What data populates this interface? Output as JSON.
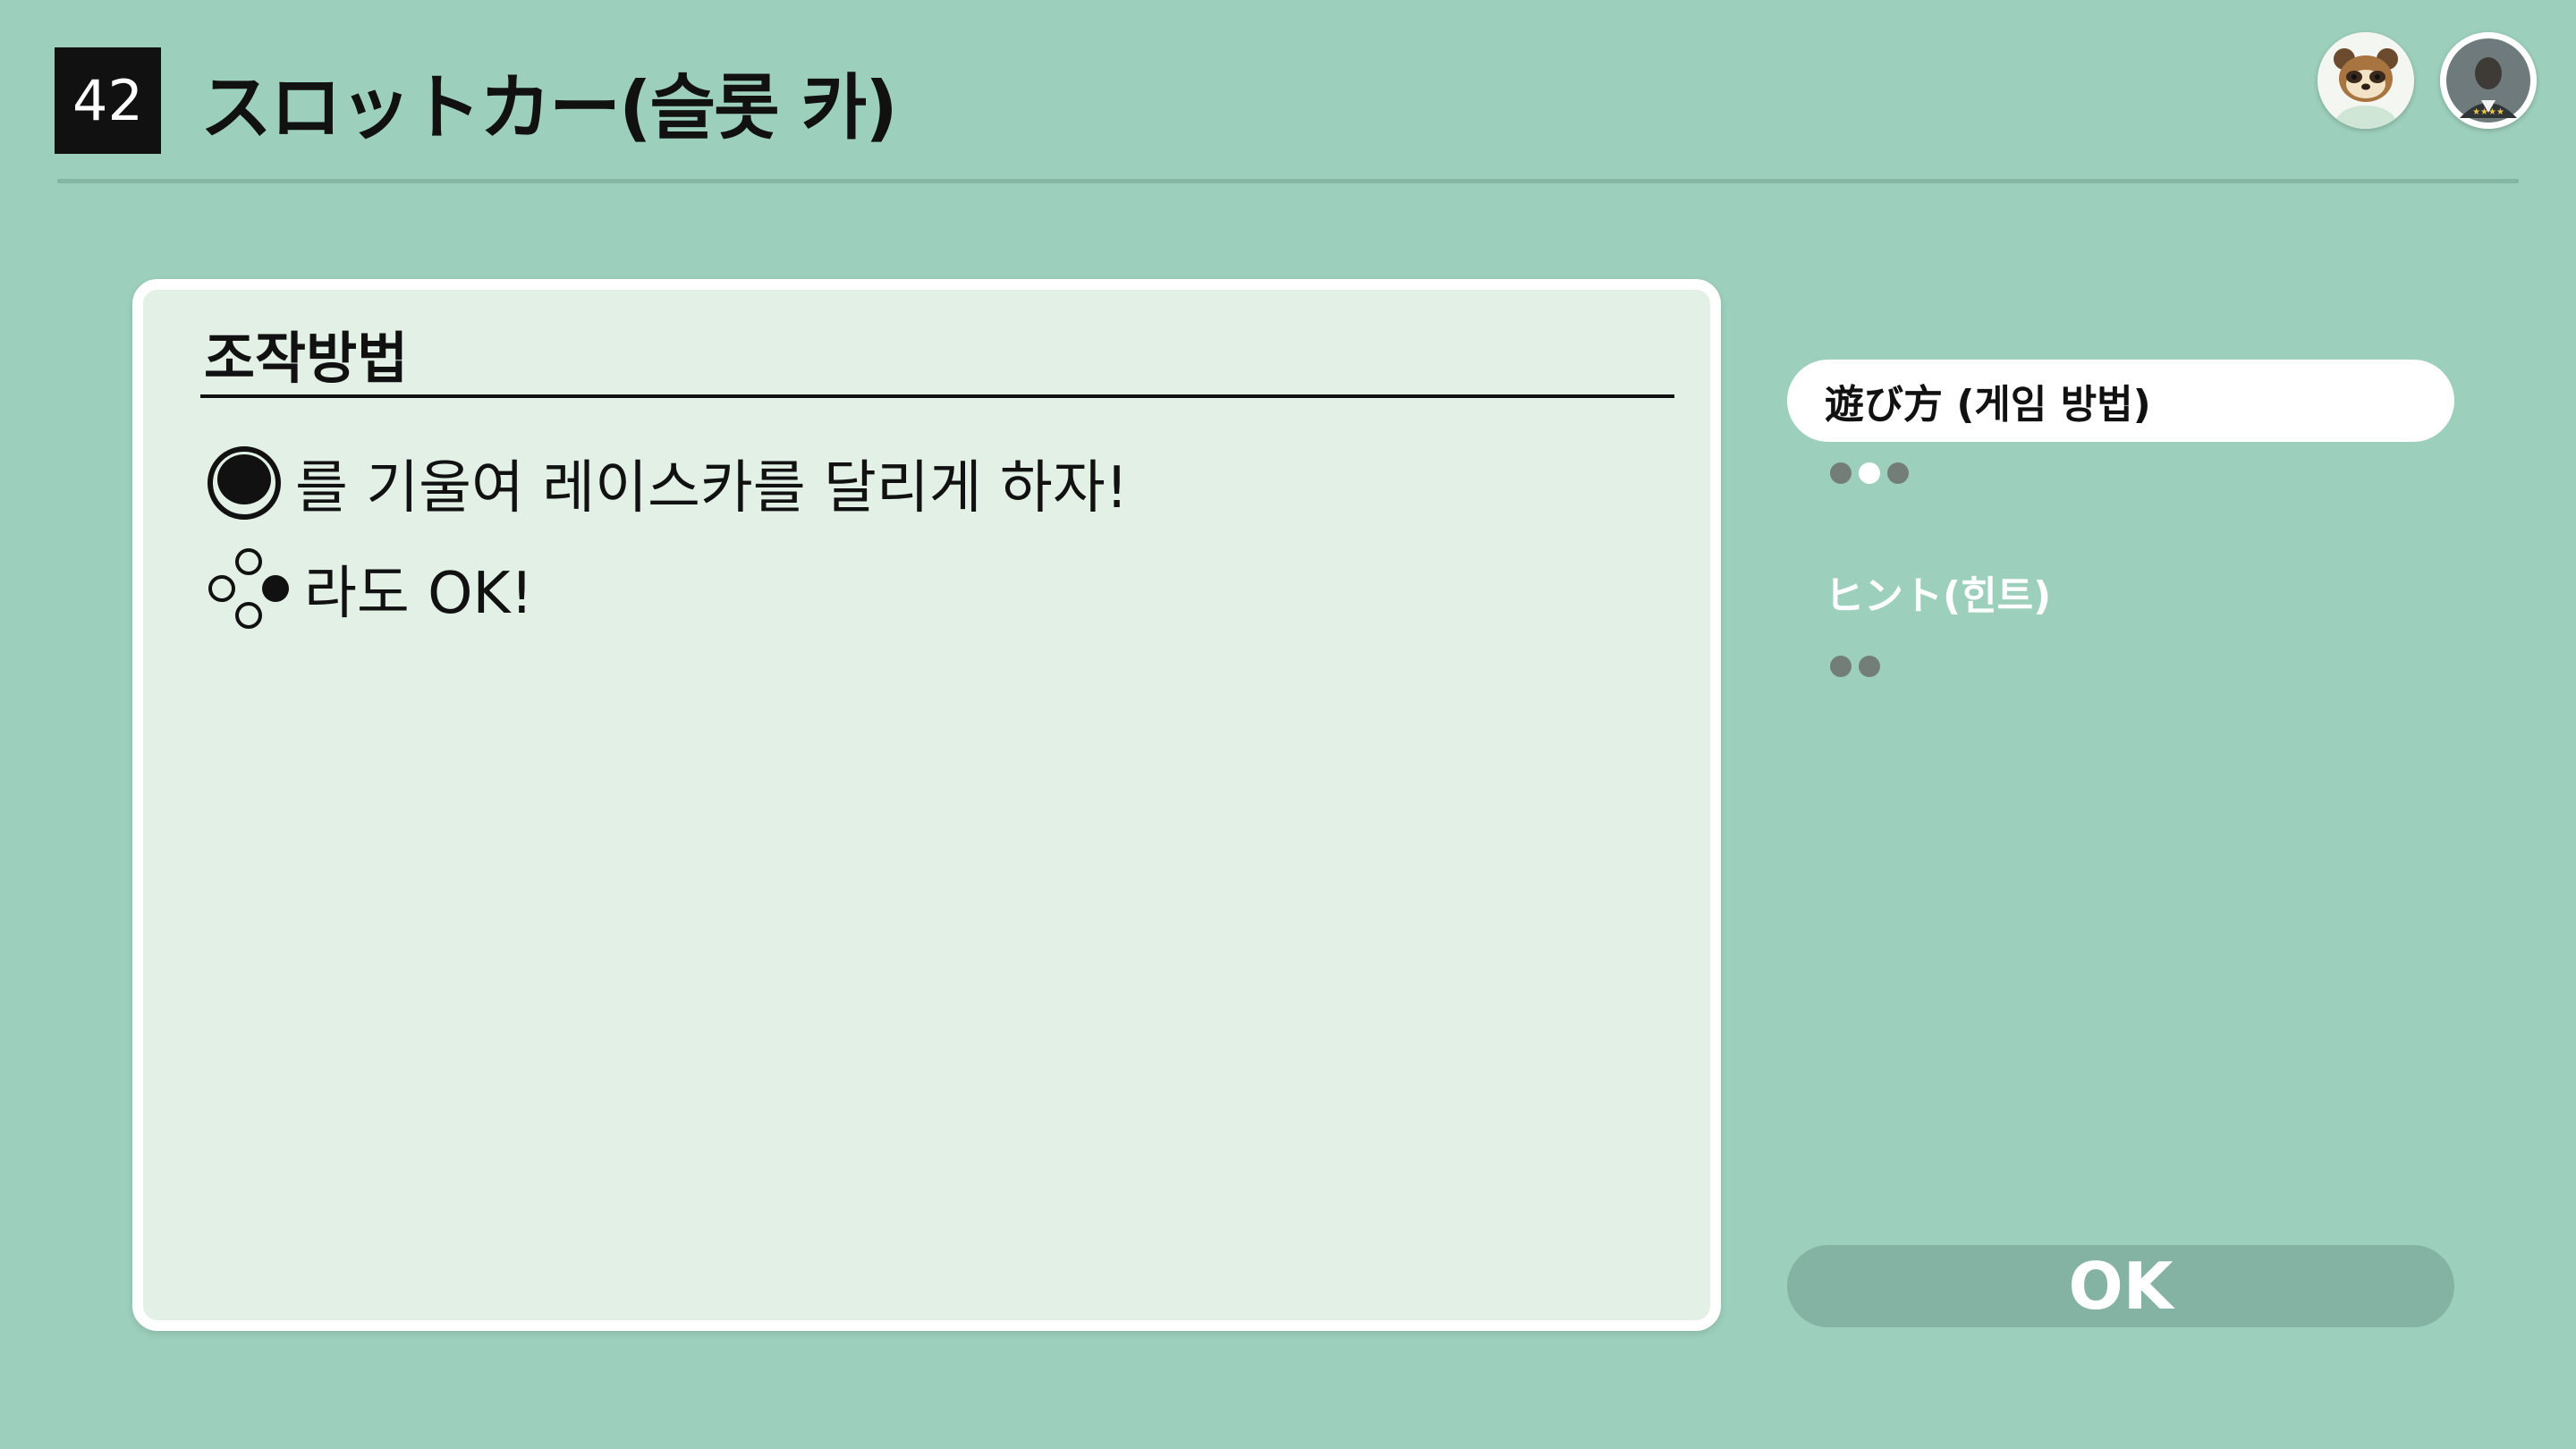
{
  "header": {
    "game_number": "42",
    "title": "スロットカー(슬롯 카)",
    "avatars": [
      {
        "icon": "raccoon-character-avatar-icon"
      },
      {
        "icon": "player-silhouette-avatar-icon"
      }
    ]
  },
  "panel": {
    "heading": "조작방법",
    "lines": [
      {
        "icon": "analog-stick-icon",
        "text": "를 기울여 레이스카를 달리게 하자!"
      },
      {
        "icon": "face-buttons-icon",
        "text": "라도 OK!"
      }
    ]
  },
  "menu": {
    "items": [
      {
        "label": "遊び方 (게임 방법)",
        "selected": true,
        "pages": 3,
        "current_page": 2
      },
      {
        "label": "ヒント(힌트)",
        "selected": false,
        "pages": 2,
        "current_page": 0
      }
    ]
  },
  "ok_label": "OK",
  "colors": {
    "background": "#9dcfbd",
    "panel": "#e2f0e6",
    "ok_button": "#84b3a3",
    "dot_inactive": "#737e79"
  }
}
